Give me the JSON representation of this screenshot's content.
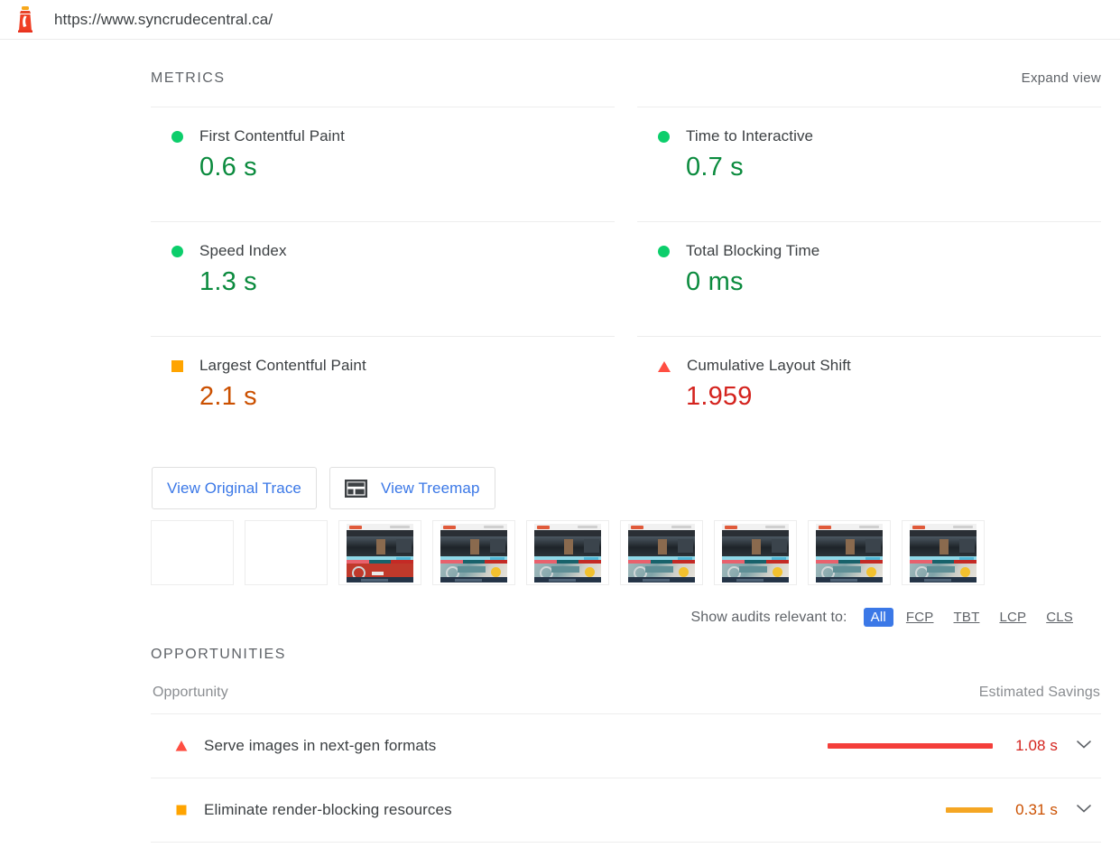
{
  "topbar": {
    "logo_icon": "lighthouse-icon",
    "url": "https://www.syncrudecentral.ca/"
  },
  "metrics_section": {
    "title": "METRICS",
    "expand_label": "Expand view",
    "items": [
      {
        "label": "First Contentful Paint",
        "value": "0.6 s",
        "rating": "pass",
        "icon": "circle-pass-icon"
      },
      {
        "label": "Time to Interactive",
        "value": "0.7 s",
        "rating": "pass",
        "icon": "circle-pass-icon"
      },
      {
        "label": "Speed Index",
        "value": "1.3 s",
        "rating": "pass",
        "icon": "circle-pass-icon"
      },
      {
        "label": "Total Blocking Time",
        "value": "0 ms",
        "rating": "pass",
        "icon": "circle-pass-icon"
      },
      {
        "label": "Largest Contentful Paint",
        "value": "2.1 s",
        "rating": "average",
        "icon": "square-average-icon"
      },
      {
        "label": "Cumulative Layout Shift",
        "value": "1.959",
        "rating": "fail",
        "icon": "triangle-fail-icon"
      }
    ]
  },
  "buttons": {
    "view_original_trace": "View Original Trace",
    "view_treemap": "View Treemap",
    "treemap_icon": "treemap-icon"
  },
  "filmstrip": {
    "frames": [
      "blank",
      "blank",
      "loaded",
      "loaded",
      "loaded",
      "loaded",
      "loaded",
      "loaded",
      "loaded"
    ]
  },
  "audit_filter": {
    "label": "Show audits relevant to:",
    "options": [
      "All",
      "FCP",
      "TBT",
      "LCP",
      "CLS"
    ],
    "selected": "All"
  },
  "opportunities": {
    "title": "OPPORTUNITIES",
    "col_opportunity": "Opportunity",
    "col_savings": "Estimated Savings",
    "rows": [
      {
        "title": "Serve images in next-gen formats",
        "savings": "1.08 s",
        "rating": "fail",
        "icon": "triangle-fail-icon",
        "bar_width_pct": 100,
        "chevron": "chevron-down-icon"
      },
      {
        "title": "Eliminate render-blocking resources",
        "savings": "0.31 s",
        "rating": "average",
        "icon": "square-average-icon",
        "bar_width_pct": 28,
        "chevron": "chevron-down-icon"
      }
    ]
  },
  "colors": {
    "pass": "#0cce6b",
    "average": "#ffa400",
    "fail": "#ff4e42",
    "pass_text": "#0b8b3e",
    "average_text": "#cb5000",
    "fail_text": "#d4231e",
    "link_blue": "#3b78e7"
  }
}
